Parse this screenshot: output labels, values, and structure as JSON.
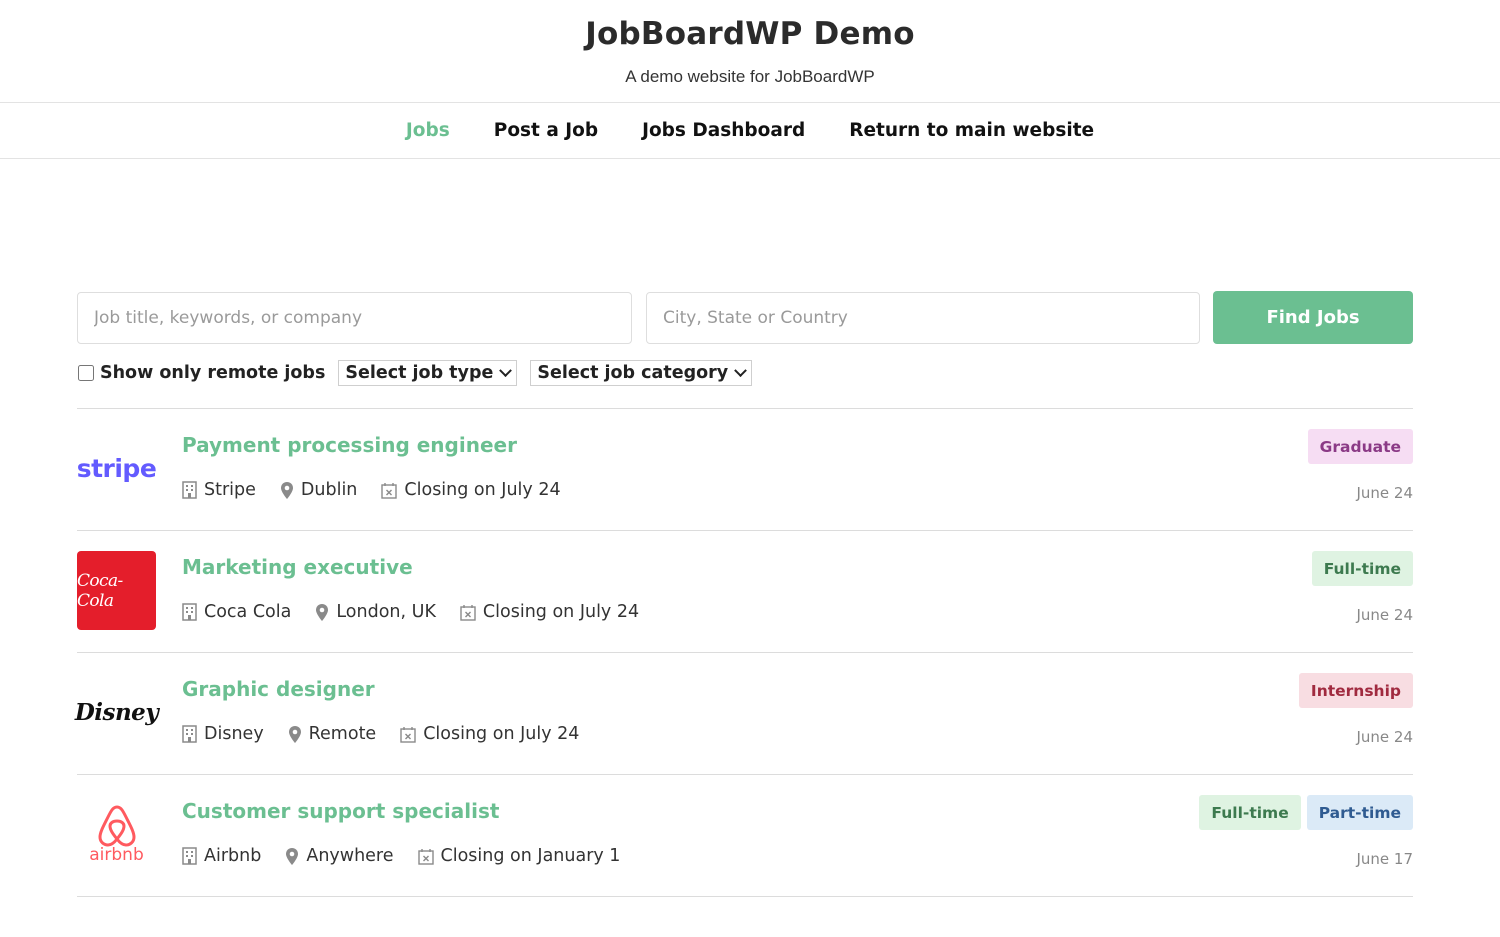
{
  "site": {
    "title": "JobBoardWP Demo",
    "tagline": "A demo website for JobBoardWP"
  },
  "nav": [
    {
      "label": "Jobs",
      "active": true
    },
    {
      "label": "Post a Job",
      "active": false
    },
    {
      "label": "Jobs Dashboard",
      "active": false
    },
    {
      "label": "Return to main website",
      "active": false
    }
  ],
  "search": {
    "keywords_placeholder": "Job title, keywords, or company",
    "keywords_value": "",
    "location_placeholder": "City, State or Country",
    "location_value": "",
    "button_label": "Find Jobs"
  },
  "filters": {
    "remote_label": "Show only remote jobs",
    "remote_checked": false,
    "job_type_selected": "Select job type",
    "job_category_selected": "Select job category"
  },
  "jobs": [
    {
      "title": "Payment processing engineer",
      "company": "Stripe",
      "location": "Dublin",
      "closing": "Closing on July 24",
      "types": [
        "Graduate"
      ],
      "posted": "June 24",
      "logo": "stripe"
    },
    {
      "title": "Marketing executive",
      "company": "Coca Cola",
      "location": "London, UK",
      "closing": "Closing on July 24",
      "types": [
        "Full-time"
      ],
      "posted": "June 24",
      "logo": "Coca-Cola"
    },
    {
      "title": "Graphic designer",
      "company": "Disney",
      "location": "Remote",
      "closing": "Closing on July 24",
      "types": [
        "Internship"
      ],
      "posted": "June 24",
      "logo": "Disney"
    },
    {
      "title": "Customer support specialist",
      "company": "Airbnb",
      "location": "Anywhere",
      "closing": "Closing on January 1",
      "types": [
        "Full-time",
        "Part-time"
      ],
      "posted": "June 17",
      "logo": "airbnb"
    }
  ],
  "colors": {
    "accent": "#6bbf91",
    "graduate_bg": "#f6ddf3",
    "fulltime_bg": "#dff3e2",
    "internship_bg": "#f8dde2",
    "parttime_bg": "#dbeaf7",
    "stripe_brand": "#635bff",
    "coca_cola_brand": "#e41e2b",
    "airbnb_brand": "#ff5a5f"
  },
  "icons": {
    "company": "building-icon",
    "location": "map-pin-icon",
    "closing": "calendar-x-icon"
  }
}
